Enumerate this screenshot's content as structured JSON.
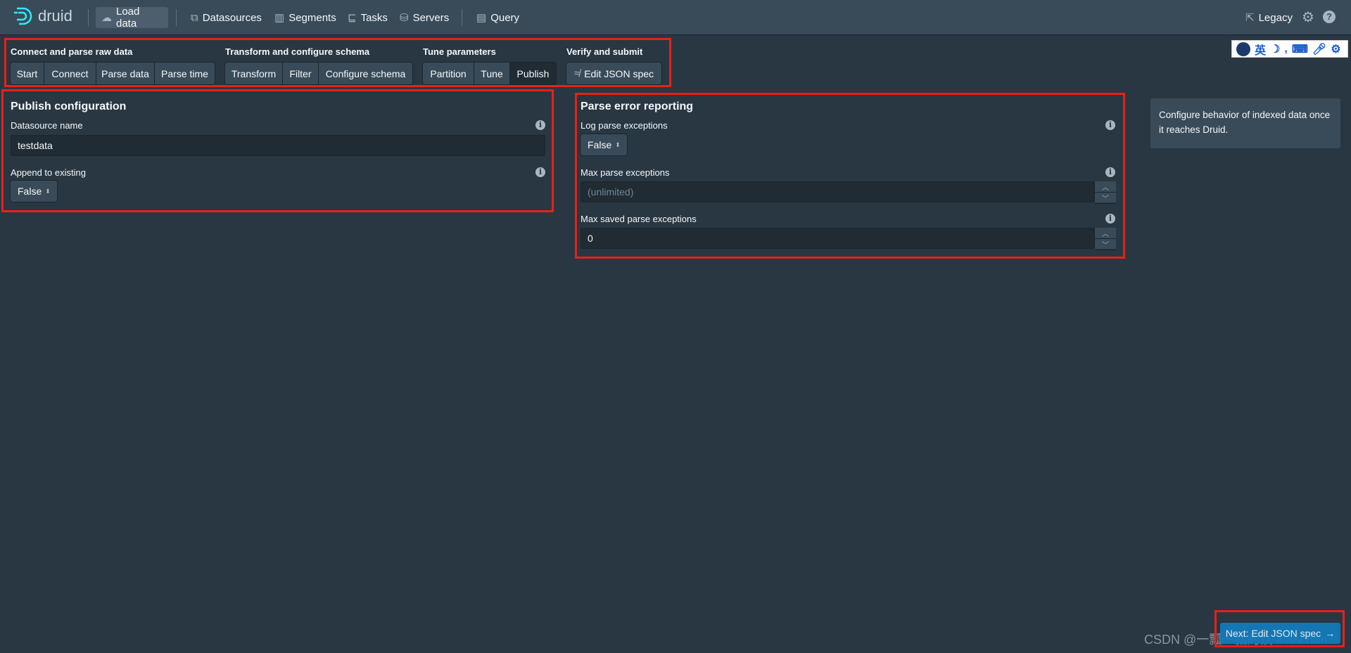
{
  "header": {
    "logo": "druid",
    "nav": [
      {
        "label": "Load data",
        "icon": "cloud-upload-icon"
      },
      {
        "label": "Datasources",
        "icon": "multi-select-icon"
      },
      {
        "label": "Segments",
        "icon": "stacked-chart-icon"
      },
      {
        "label": "Tasks",
        "icon": "gantt-chart-icon"
      },
      {
        "label": "Servers",
        "icon": "database-icon"
      },
      {
        "label": "Query",
        "icon": "application-icon"
      }
    ],
    "legacy": "Legacy"
  },
  "steps": {
    "groups": [
      {
        "label": "Connect and parse raw data",
        "items": [
          "Start",
          "Connect",
          "Parse data",
          "Parse time"
        ]
      },
      {
        "label": "Transform and configure schema",
        "items": [
          "Transform",
          "Filter",
          "Configure schema"
        ]
      },
      {
        "label": "Tune parameters",
        "items": [
          "Partition",
          "Tune",
          "Publish"
        ]
      },
      {
        "label": "Verify and submit",
        "items": [
          "Edit JSON spec"
        ]
      }
    ],
    "active": "Publish"
  },
  "publish": {
    "title": "Publish configuration",
    "datasource_label": "Datasource name",
    "datasource_value": "testdata",
    "append_label": "Append to existing",
    "append_value": "False"
  },
  "parse_errors": {
    "title": "Parse error reporting",
    "log_label": "Log parse exceptions",
    "log_value": "False",
    "max_label": "Max parse exceptions",
    "max_placeholder": "(unlimited)",
    "max_saved_label": "Max saved parse exceptions",
    "max_saved_value": "0"
  },
  "info_text": "Configure behavior of indexed data once it reaches Druid.",
  "next_button": "Next: Edit JSON spec",
  "ime": {
    "mode": "英"
  },
  "watermark": "CSDN @一瓢一瓢的饮 alanchan",
  "colors": {
    "background": "#293742",
    "header": "#394b59",
    "accent": "#137cbd",
    "annotation": "#e8201b"
  }
}
